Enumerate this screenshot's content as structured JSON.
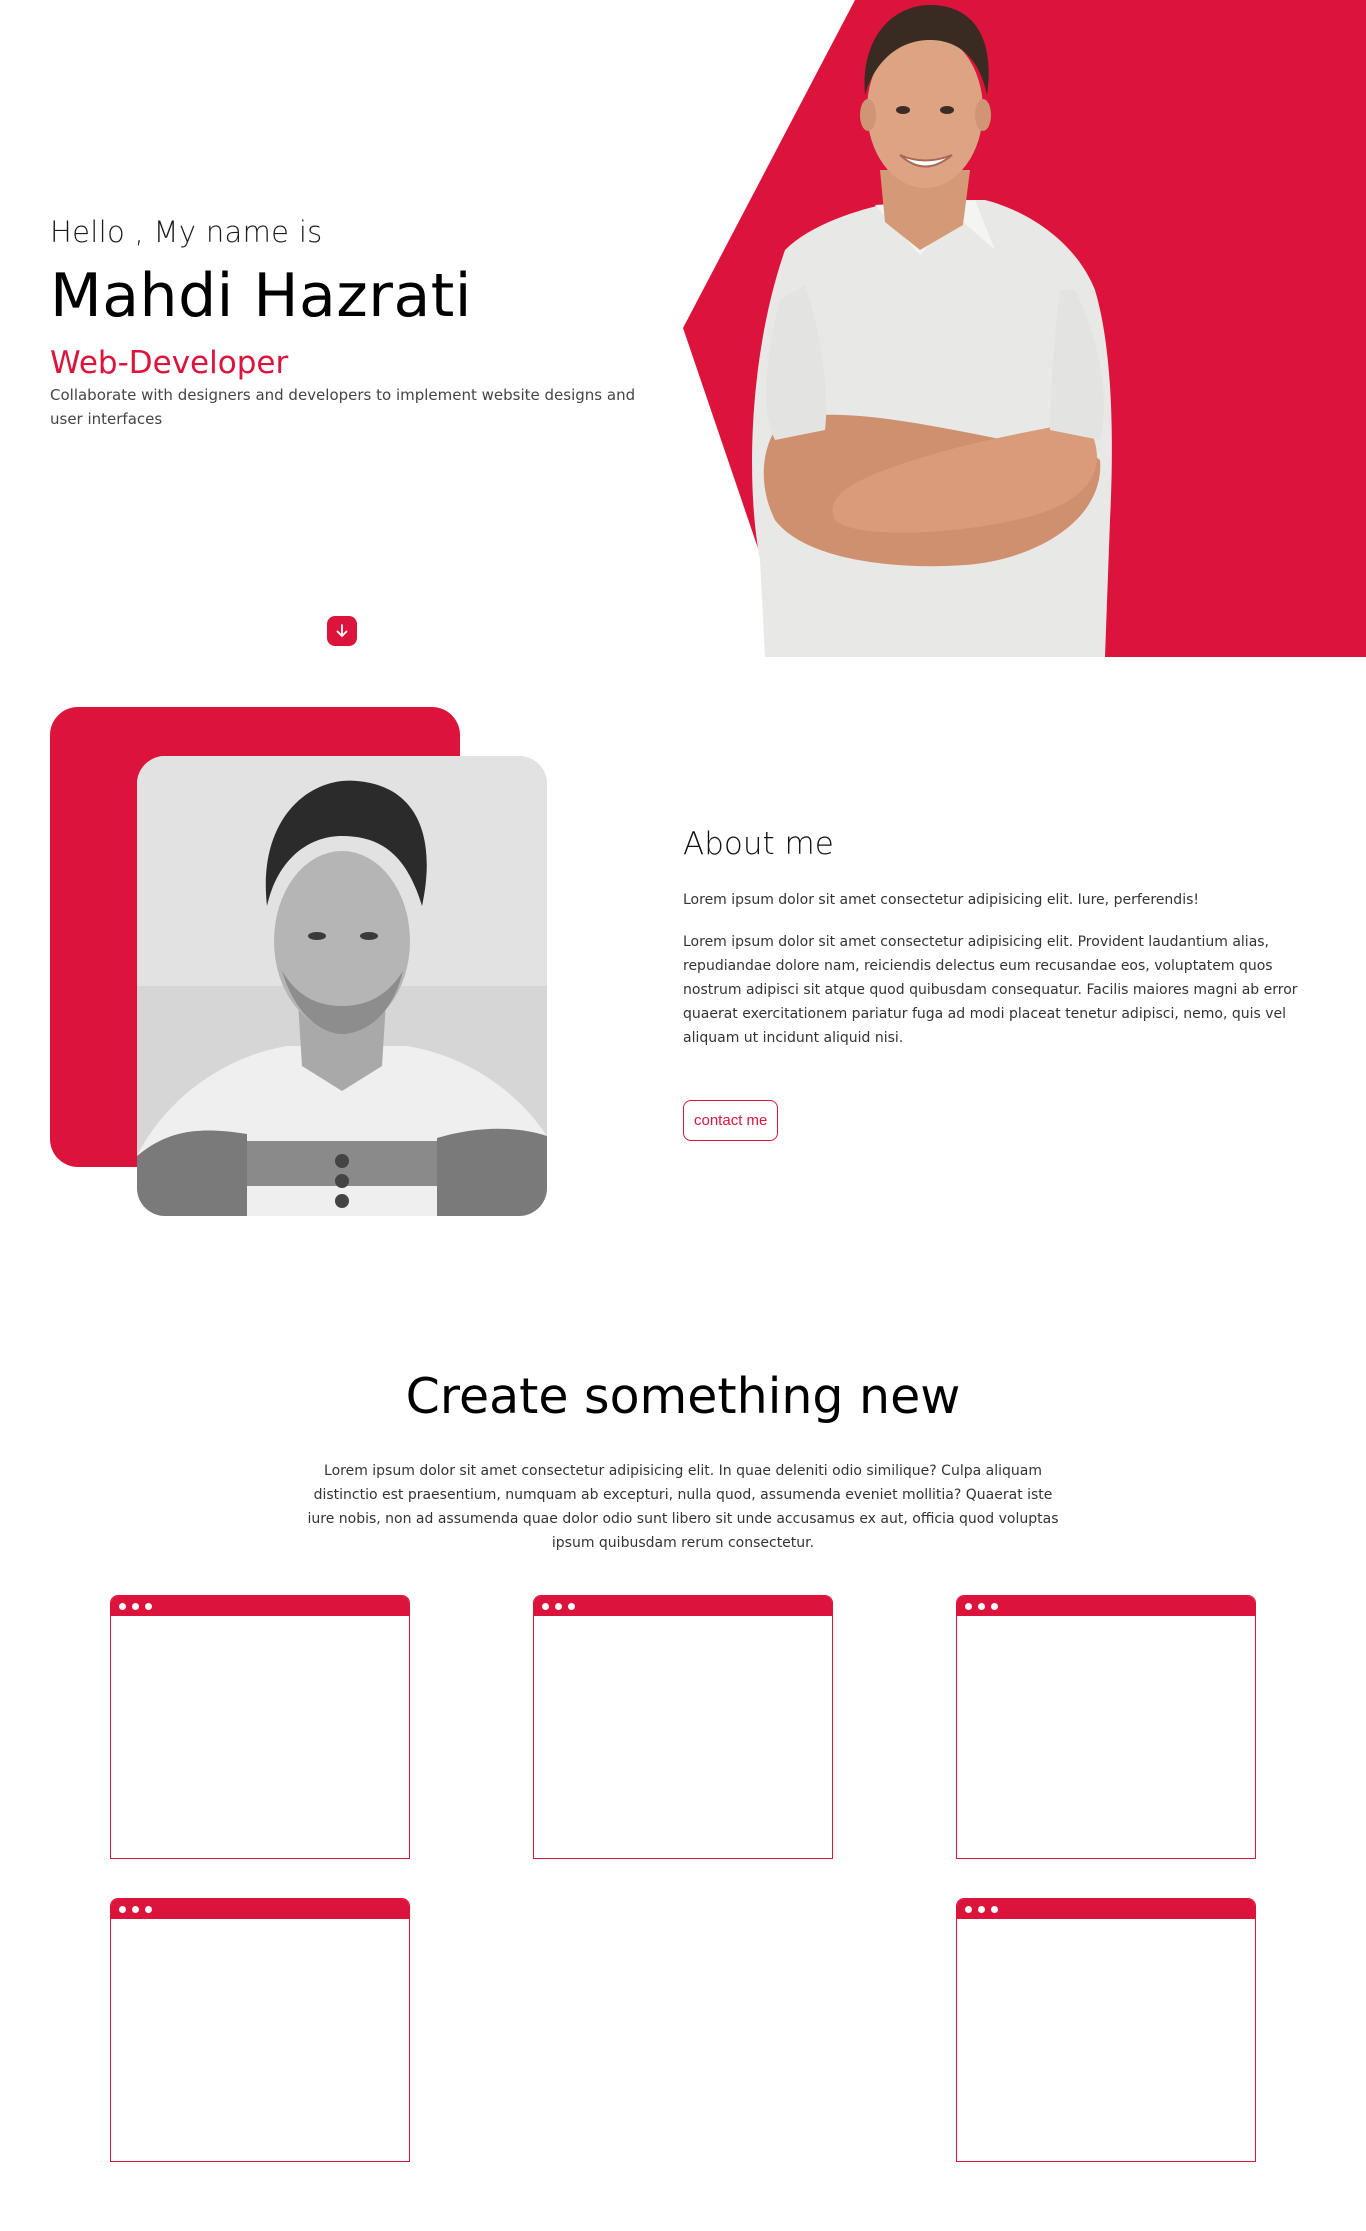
{
  "colors": {
    "accent": "#dc143c",
    "background": "#ffffff"
  },
  "hero": {
    "greeting": "Hello , My name is",
    "name": "Mahdi Hazrati",
    "role": "Web-Developer",
    "tagline": "Collaborate with designers and developers to implement website designs and user interfaces",
    "scroll_icon": "arrow-down-icon"
  },
  "about": {
    "title": "About me",
    "paragraph1": "Lorem ipsum dolor sit amet consectetur adipisicing elit. Iure, perferendis!",
    "paragraph2": "Lorem ipsum dolor sit amet consectetur adipisicing elit. Provident laudantium alias, repudiandae dolore nam, reiciendis delectus eum recusandae eos, voluptatem quos nostrum adipisci sit atque quod quibusdam consequatur. Facilis maiores magni ab error quaerat exercitationem pariatur fuga ad modi placeat tenetur adipisci, nemo, quis vel aliquam ut incidunt aliquid nisi.",
    "contact_label": "contact me"
  },
  "create": {
    "title": "Create something new",
    "paragraph": "Lorem ipsum dolor sit amet consectetur adipisicing elit. In quae deleniti odio similique? Culpa aliquam distinctio est praesentium, numquam ab excepturi, nulla quod, assumenda eveniet mollitia? Quaerat iste iure nobis, non ad assumenda quae dolor odio sunt libero sit unde accusamus ex aut, officia quod voluptas ipsum quibusdam rerum consectetur.",
    "project_count": 5
  }
}
